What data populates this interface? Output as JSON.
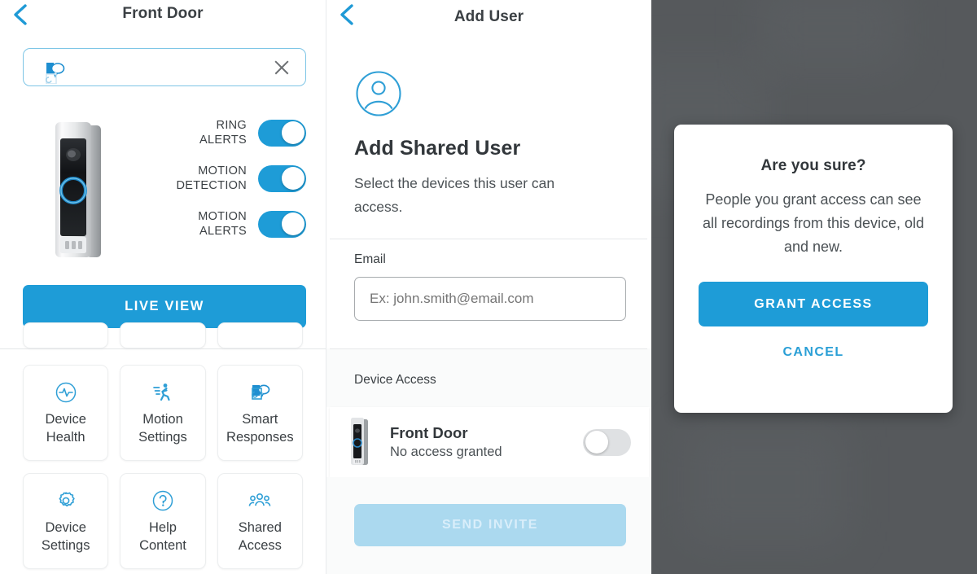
{
  "colors": {
    "accent": "#1e9cd7",
    "accent_light": "#abd9ef",
    "link": "#2a9fd6",
    "text_dark": "#32373b",
    "text_body": "#4b5155",
    "scrim": "#56595c",
    "toggle_off": "#dfe1e3"
  },
  "left_panel": {
    "header": {
      "title": "Front Door",
      "back_icon": "chevron-left-icon"
    },
    "name_field": {
      "value": "",
      "glyph_icon": "smart-responses-icon",
      "clear_icon": "close-x-icon"
    },
    "device_image_alt": "ring-video-doorbell-pro",
    "toggles": [
      {
        "label": "RING ALERTS",
        "label_lines": [
          "RING",
          "ALERTS"
        ],
        "state": "on"
      },
      {
        "label": "MOTION DETECTION",
        "label_lines": [
          "MOTION",
          "DETECTION"
        ],
        "state": "on"
      },
      {
        "label": "MOTION ALERTS",
        "label_lines": [
          "MOTION",
          "ALERTS"
        ],
        "state": "on"
      }
    ],
    "live_view_label": "LIVE VIEW",
    "tiles": [
      {
        "label_lines": [
          "Device",
          "Health"
        ],
        "label": "Device Health",
        "icon": "device-health-pulse-icon"
      },
      {
        "label_lines": [
          "Motion",
          "Settings"
        ],
        "label": "Motion Settings",
        "icon": "running-person-icon"
      },
      {
        "label_lines": [
          "Smart",
          "Responses"
        ],
        "label": "Smart Responses",
        "icon": "smart-responses-icon"
      },
      {
        "label_lines": [
          "Device",
          "Settings"
        ],
        "label": "Device Settings",
        "icon": "gear-icon"
      },
      {
        "label_lines": [
          "Help",
          "Content"
        ],
        "label": "Help Content",
        "icon": "question-mark-icon"
      },
      {
        "label_lines": [
          "Shared",
          "Access"
        ],
        "label": "Shared Access",
        "icon": "people-group-icon"
      }
    ]
  },
  "mid_panel": {
    "header": {
      "title": "Add User",
      "back_icon": "chevron-left-icon"
    },
    "avatar_icon": "user-circle-icon",
    "heading": "Add Shared User",
    "subtitle": "Select the devices this user can access.",
    "email_label": "Email",
    "email_value": "",
    "email_placeholder": "Ex: john.smith@email.com",
    "device_access_label": "Device Access",
    "device_row": {
      "name": "Front Door",
      "status": "No access granted",
      "thumb_icon": "doorbell-thumbnail",
      "toggle_state": "off"
    },
    "send_invite_label": "SEND INVITE",
    "send_invite_disabled": true
  },
  "right_panel": {
    "dialog": {
      "title": "Are you sure?",
      "body": "People you grant access can see all recordings from this device, old and new.",
      "primary_label": "GRANT ACCESS",
      "secondary_label": "CANCEL"
    }
  }
}
